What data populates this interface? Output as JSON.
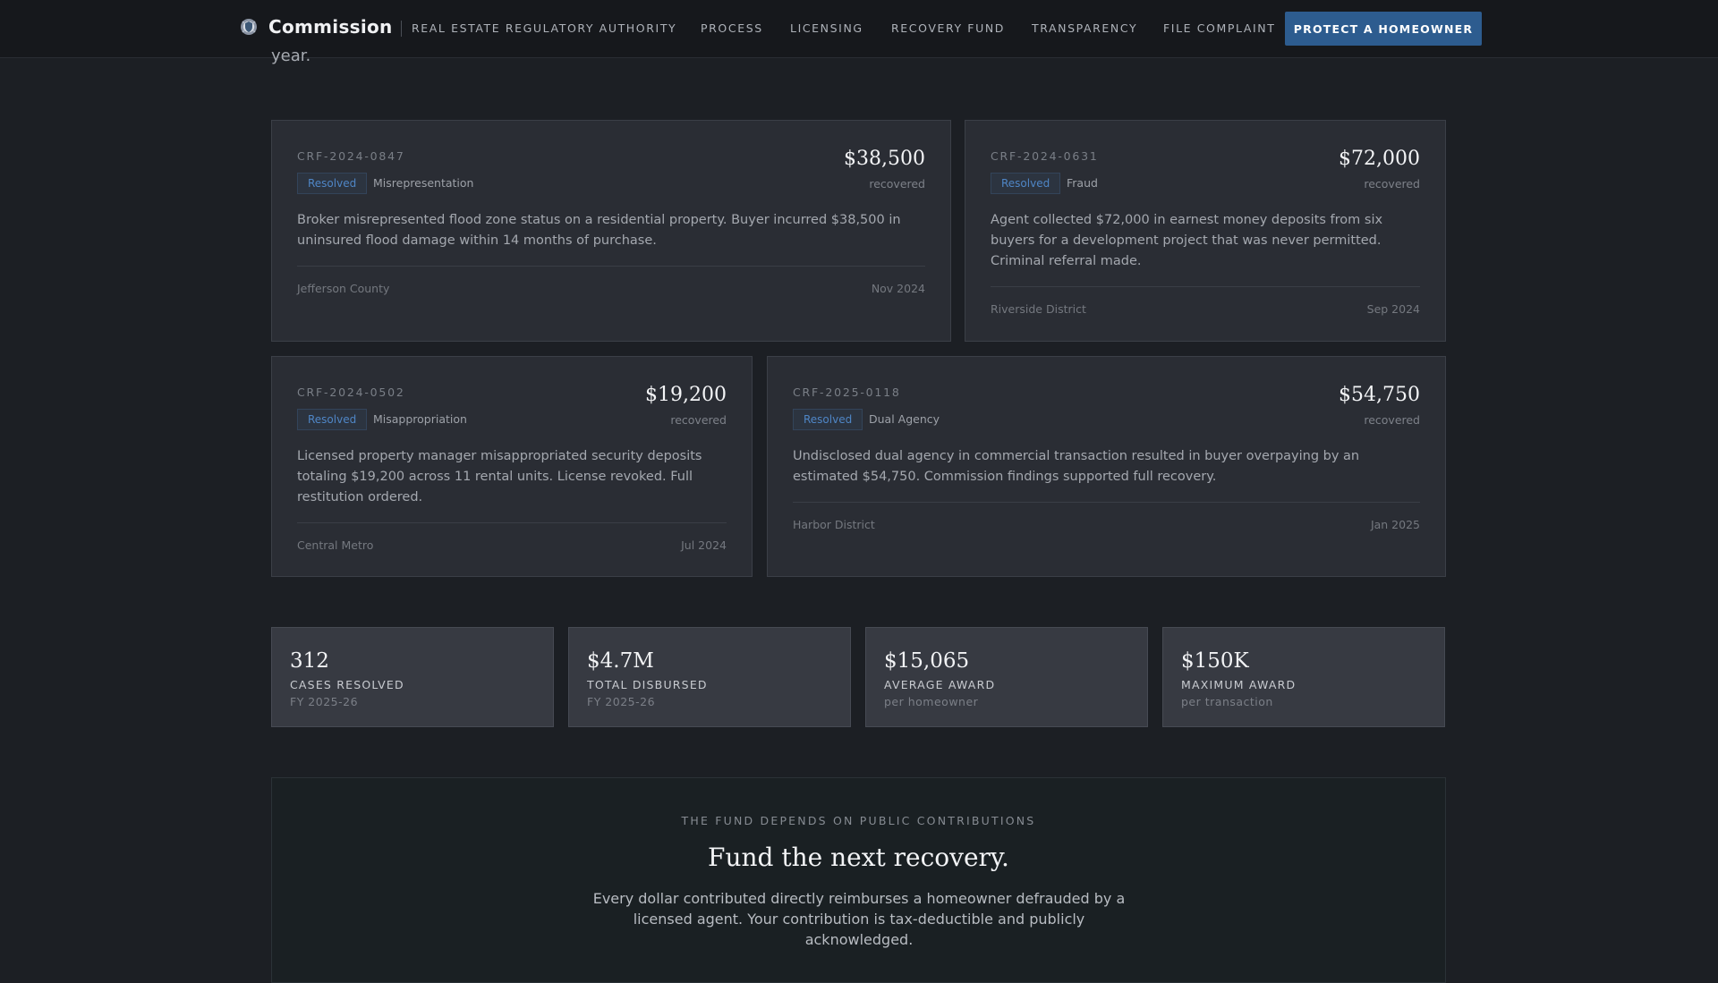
{
  "nav": {
    "brand": "Commission",
    "links": [
      "REAL ESTATE REGULATORY AUTHORITY",
      "PROCESS",
      "LICENSING",
      "RECOVERY FUND",
      "TRANSPARENCY",
      "FILE COMPLAINT"
    ],
    "cta": "PROTECT A HOMEOWNER"
  },
  "intro_overflow": "year.",
  "cases": [
    {
      "id": "CRF-2024-0847",
      "status": "Resolved",
      "category": "Misrepresentation",
      "amount": "$38,500",
      "amount_label": "recovered",
      "description": "Broker misrepresented flood zone status on a residential property. Buyer incurred $38,500 in uninsured flood damage within 14 months of purchase.",
      "location": "Jefferson County",
      "date": "Nov 2024"
    },
    {
      "id": "CRF-2024-0631",
      "status": "Resolved",
      "category": "Fraud",
      "amount": "$72,000",
      "amount_label": "recovered",
      "description": "Agent collected $72,000 in earnest money deposits from six buyers for a development project that was never permitted. Criminal referral made.",
      "location": "Riverside District",
      "date": "Sep 2024"
    },
    {
      "id": "CRF-2024-0502",
      "status": "Resolved",
      "category": "Misappropriation",
      "amount": "$19,200",
      "amount_label": "recovered",
      "description": "Licensed property manager misappropriated security deposits totaling $19,200 across 11 rental units. License revoked. Full restitution ordered.",
      "location": "Central Metro",
      "date": "Jul 2024"
    },
    {
      "id": "CRF-2025-0118",
      "status": "Resolved",
      "category": "Dual Agency",
      "amount": "$54,750",
      "amount_label": "recovered",
      "description": "Undisclosed dual agency in commercial transaction resulted in buyer overpaying by an estimated $54,750. Commission findings supported full recovery.",
      "location": "Harbor District",
      "date": "Jan 2025"
    }
  ],
  "stats": [
    {
      "value": "312",
      "label": "CASES RESOLVED",
      "sub": "FY 2025-26"
    },
    {
      "value": "$4.7M",
      "label": "TOTAL DISBURSED",
      "sub": "FY 2025-26"
    },
    {
      "value": "$15,065",
      "label": "AVERAGE AWARD",
      "sub": "per homeowner"
    },
    {
      "value": "$150K",
      "label": "MAXIMUM AWARD",
      "sub": "per transaction"
    }
  ],
  "cta": {
    "kicker": "THE FUND DEPENDS ON PUBLIC CONTRIBUTIONS",
    "title": "Fund the next recovery.",
    "body": "Every dollar contributed directly reimburses a homeowner defrauded by a licensed agent. Your contribution is tax-deductible and publicly acknowledged."
  },
  "colors": {
    "background": "#1c1f24",
    "card": "#2a2d34",
    "accent": "#2d5c8f",
    "badge_text": "#4f86c6"
  }
}
